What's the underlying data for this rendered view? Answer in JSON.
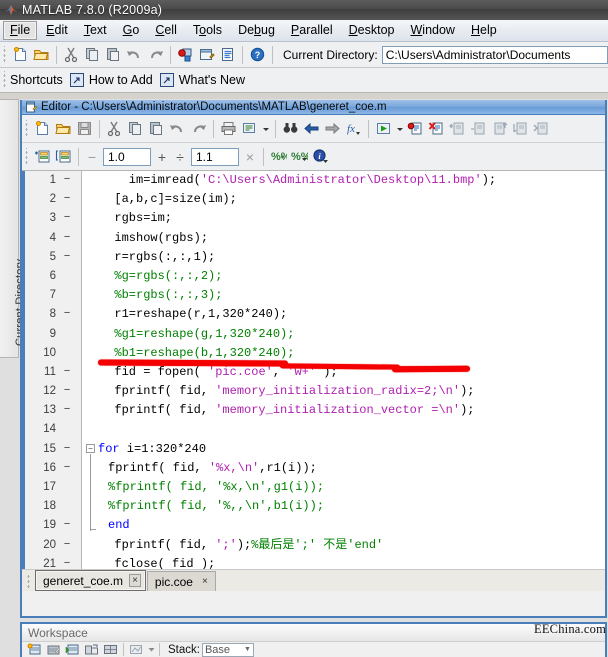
{
  "window": {
    "title": "MATLAB  7.8.0 (R2009a)",
    "logo_icon": "matlab-logo-icon"
  },
  "menubar": {
    "items": [
      {
        "label": "File",
        "accel": "F",
        "selected": true
      },
      {
        "label": "Edit",
        "accel": "E",
        "selected": false
      },
      {
        "label": "Text",
        "accel": "T",
        "selected": false
      },
      {
        "label": "Go",
        "accel": "G",
        "selected": false
      },
      {
        "label": "Cell",
        "accel": "C",
        "selected": false
      },
      {
        "label": "Tools",
        "accel": "o",
        "selected": false
      },
      {
        "label": "Debug",
        "accel": "b",
        "selected": false
      },
      {
        "label": "Parallel",
        "accel": "P",
        "selected": false
      },
      {
        "label": "Desktop",
        "accel": "D",
        "selected": false
      },
      {
        "label": "Window",
        "accel": "W",
        "selected": false
      },
      {
        "label": "Help",
        "accel": "H",
        "selected": false
      }
    ]
  },
  "toolbar": {
    "buttons": [
      {
        "name": "new-file-icon",
        "title": "New"
      },
      {
        "name": "open-file-icon",
        "title": "Open"
      },
      {
        "name": "cut-icon",
        "title": "Cut"
      },
      {
        "name": "copy-icon",
        "title": "Copy"
      },
      {
        "name": "paste-icon",
        "title": "Paste"
      },
      {
        "name": "undo-icon",
        "title": "Undo"
      },
      {
        "name": "redo-icon",
        "title": "Redo"
      },
      {
        "name": "simulink-icon",
        "title": "Simulink"
      },
      {
        "name": "guide-icon",
        "title": "GUIDE"
      },
      {
        "name": "profiler-icon",
        "title": "Profiler"
      },
      {
        "name": "help-icon",
        "title": "Help"
      }
    ],
    "current_directory_label": "Current Directory:",
    "current_directory_value": "C:\\Users\\Administrator\\Documents"
  },
  "shortcuts_bar": {
    "label": "Shortcuts",
    "items": [
      {
        "label": "How to Add",
        "icon": "shortcut-arrow-icon"
      },
      {
        "label": "What's New",
        "icon": "shortcut-arrow-icon"
      }
    ]
  },
  "left_dock": {
    "tab_label": "Current Directory"
  },
  "editor": {
    "title": "Editor - C:\\Users\\Administrator\\Documents\\MATLAB\\generet_coe.m",
    "title_icon": "editor-document-icon",
    "toolbar_buttons": [
      {
        "name": "new-file-icon"
      },
      {
        "name": "open-file-icon"
      },
      {
        "name": "save-icon"
      },
      {
        "name": "cut-icon"
      },
      {
        "name": "copy-icon"
      },
      {
        "name": "paste-icon"
      },
      {
        "name": "undo-icon"
      },
      {
        "name": "redo-icon"
      },
      {
        "name": "print-icon"
      },
      {
        "name": "comment-block-icon"
      },
      {
        "name": "dropdown-arrow-icon"
      },
      {
        "name": "find-binoculars-icon"
      },
      {
        "name": "back-arrow-icon"
      },
      {
        "name": "forward-arrow-icon"
      },
      {
        "name": "function-browser-icon"
      },
      {
        "name": "run-icon"
      },
      {
        "name": "run-dropdown-arrow-icon"
      },
      {
        "name": "set-breakpoint-icon"
      },
      {
        "name": "clear-breakpoints-icon"
      },
      {
        "name": "step-in-icon"
      },
      {
        "name": "step-icon"
      },
      {
        "name": "step-out-icon"
      },
      {
        "name": "continue-icon"
      },
      {
        "name": "exit-debug-icon"
      }
    ],
    "cell_toolbar": {
      "buttons": [
        {
          "name": "insert-cell-icon"
        },
        {
          "name": "insert-cell-divider-icon"
        }
      ],
      "minus_label": "−",
      "value_divide_base": "1.0",
      "plus_label": "+",
      "divide_label": "÷",
      "value_multiply_base": "1.1",
      "times_label": "×",
      "cell_mode_icons": [
        {
          "name": "show-cell-titles-icon"
        },
        {
          "name": "cell-options-icon"
        },
        {
          "name": "cell-info-icon"
        }
      ]
    },
    "annotation": {
      "type": "red-underline-highlight",
      "color": "#f40000"
    },
    "code_lines": [
      {
        "num": "1",
        "exec": true,
        "tokens": [
          {
            "t": "    im=imread(",
            "c": ""
          },
          {
            "t": "'C:\\Users\\Administrator\\Desktop\\11.bmp'",
            "c": "str"
          },
          {
            "t": ");",
            "c": ""
          }
        ]
      },
      {
        "num": "2",
        "exec": true,
        "tokens": [
          {
            "t": "  [a,b,c]=size(im);",
            "c": ""
          }
        ]
      },
      {
        "num": "3",
        "exec": true,
        "tokens": [
          {
            "t": "  rgbs=im;",
            "c": ""
          }
        ]
      },
      {
        "num": "4",
        "exec": true,
        "tokens": [
          {
            "t": "  imshow(rgbs);",
            "c": ""
          }
        ]
      },
      {
        "num": "5",
        "exec": true,
        "tokens": [
          {
            "t": "  r=rgbs(:,:,1);",
            "c": ""
          }
        ]
      },
      {
        "num": "6",
        "exec": false,
        "tokens": [
          {
            "t": "  %g=rgbs(:,:,2);",
            "c": "cmt"
          }
        ]
      },
      {
        "num": "7",
        "exec": false,
        "tokens": [
          {
            "t": "  %b=rgbs(:,:,3);",
            "c": "cmt"
          }
        ]
      },
      {
        "num": "8",
        "exec": true,
        "tokens": [
          {
            "t": "  r1=reshape(r,1,320*240);",
            "c": ""
          }
        ]
      },
      {
        "num": "9",
        "exec": false,
        "tokens": [
          {
            "t": "  %g1=reshape(g,1,320*240);",
            "c": "cmt"
          }
        ]
      },
      {
        "num": "10",
        "exec": false,
        "tokens": [
          {
            "t": "  %b1=reshape(b,1,320*240);",
            "c": "cmt"
          }
        ]
      },
      {
        "num": "11",
        "exec": true,
        "tokens": [
          {
            "t": "  fid = fopen( ",
            "c": ""
          },
          {
            "t": "'pic.coe'",
            "c": "str"
          },
          {
            "t": ", ",
            "c": ""
          },
          {
            "t": "'w+'",
            "c": "str"
          },
          {
            "t": " );",
            "c": ""
          }
        ]
      },
      {
        "num": "12",
        "exec": true,
        "tokens": [
          {
            "t": "  fprintf( fid, ",
            "c": ""
          },
          {
            "t": "'memory_initialization_radix=2;\\n'",
            "c": "str"
          },
          {
            "t": ");",
            "c": ""
          }
        ]
      },
      {
        "num": "13",
        "exec": true,
        "tokens": [
          {
            "t": "  fprintf( fid, ",
            "c": ""
          },
          {
            "t": "'memory_initialization_vector =\\n'",
            "c": "str"
          },
          {
            "t": ");",
            "c": ""
          }
        ]
      },
      {
        "num": "14",
        "exec": false,
        "tokens": [
          {
            "t": "",
            "c": ""
          }
        ]
      },
      {
        "num": "15",
        "exec": true,
        "fold": "open",
        "tokens": [
          {
            "t": "for",
            "c": "kw"
          },
          {
            "t": " i=1:320*240",
            "c": ""
          }
        ]
      },
      {
        "num": "16",
        "exec": true,
        "indent": true,
        "tokens": [
          {
            "t": "fprintf( fid, ",
            "c": ""
          },
          {
            "t": "'%x,\\n'",
            "c": "str"
          },
          {
            "t": ",r1(i));",
            "c": ""
          }
        ]
      },
      {
        "num": "17",
        "exec": false,
        "indent": true,
        "tokens": [
          {
            "t": "%fprintf( fid, '%x,\\n',g1(i));",
            "c": "cmt"
          }
        ]
      },
      {
        "num": "18",
        "exec": false,
        "indent": true,
        "tokens": [
          {
            "t": "%fprintf( fid, '%,,\\n',b1(i));",
            "c": "cmt"
          }
        ]
      },
      {
        "num": "19",
        "exec": true,
        "foldend": true,
        "indent": true,
        "tokens": [
          {
            "t": "end",
            "c": "kw"
          }
        ]
      },
      {
        "num": "20",
        "exec": true,
        "tokens": [
          {
            "t": "  fprintf( fid, ",
            "c": ""
          },
          {
            "t": "';'",
            "c": "str"
          },
          {
            "t": ");",
            "c": ""
          },
          {
            "t": "%最后是';' 不是'end'",
            "c": "cmt"
          }
        ]
      },
      {
        "num": "21",
        "exec": true,
        "tokens": [
          {
            "t": "  fclose( fid );",
            "c": ""
          }
        ]
      }
    ],
    "document_tabs": [
      {
        "label": "generet_coe.m",
        "active": true,
        "close": "×"
      },
      {
        "label": "pic.coe",
        "active": false,
        "close": "×"
      }
    ]
  },
  "workspace": {
    "title": "Workspace",
    "buttons": [
      {
        "name": "new-variable-icon"
      },
      {
        "name": "open-variable-icon"
      },
      {
        "name": "import-data-icon"
      },
      {
        "name": "save-workspace-icon"
      },
      {
        "name": "plot-selection-icon"
      },
      {
        "name": "plot-type-icon"
      }
    ],
    "stack_label": "Stack:",
    "stack_value": "Base"
  },
  "watermark": {
    "text": "EEChina.com"
  }
}
